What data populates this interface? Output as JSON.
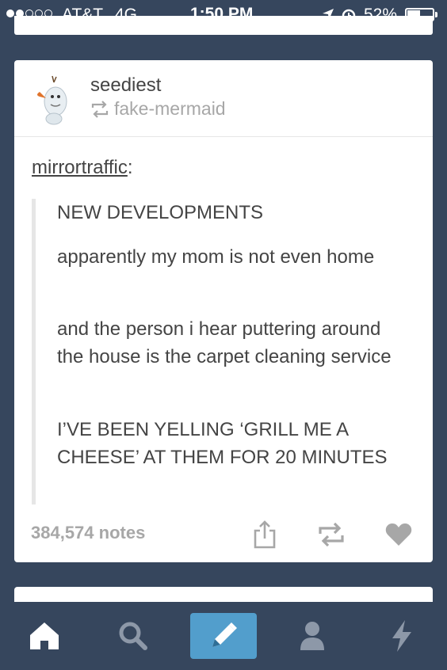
{
  "status_bar": {
    "carrier": "AT&T",
    "network": "4G",
    "time": "1:50 PM",
    "battery_percent": "52%",
    "battery_level": 0.52,
    "signal_bars_filled": 2,
    "signal_bars_total": 5
  },
  "post": {
    "author": "seediest",
    "reblogged_from": "fake-mermaid",
    "source_author": "mirrortraffic",
    "source_suffix": ":",
    "paragraphs": [
      "NEW DEVELOPMENTS",
      "apparently my mom is not even home",
      "and the person i hear puttering around the house is the carpet cleaning service",
      "I’VE BEEN YELLING ‘GRILL ME A CHEESE’ AT THEM FOR 20 MINUTES"
    ],
    "notes": "384,574 notes",
    "actions": [
      "share-icon",
      "reblog-icon",
      "like-icon"
    ]
  },
  "tab_bar": {
    "tabs": [
      "home-icon",
      "search-icon",
      "compose-icon",
      "account-icon",
      "activity-icon"
    ],
    "active_color": "#529ecc"
  },
  "colors": {
    "dashboard_bg": "#36465d",
    "text": "#444444",
    "muted": "#a7a7a7"
  }
}
